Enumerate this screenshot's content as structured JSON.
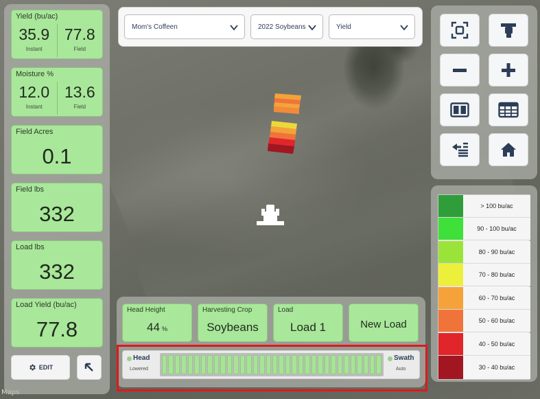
{
  "metrics": {
    "yield": {
      "title": "Yield (bu/ac)",
      "instant": "35.9",
      "instant_label": "Instant",
      "field": "77.8",
      "field_label": "Field"
    },
    "moisture": {
      "title": "Moisture %",
      "instant": "12.0",
      "instant_label": "Instant",
      "field": "13.6",
      "field_label": "Field"
    },
    "field_acres": {
      "title": "Field Acres",
      "value": "0.1"
    },
    "field_lbs": {
      "title": "Field lbs",
      "value": "332"
    },
    "load_lbs": {
      "title": "Load lbs",
      "value": "332"
    },
    "load_yield": {
      "title": "Load Yield (bu/ac)",
      "value": "77.8"
    }
  },
  "edit_button": {
    "label": "EDIT",
    "icon": "gear-icon"
  },
  "expand_button": {
    "icon": "arrow-up-left-icon"
  },
  "selects": {
    "farm": "Mom's Coffeen",
    "crop_year": "2022 Soybeans",
    "layer": "Yield"
  },
  "right_buttons": [
    {
      "name": "focus-button",
      "icon": "focus-frame-icon"
    },
    {
      "name": "combine-view-button",
      "icon": "combine-icon"
    },
    {
      "name": "zoom-out-button",
      "icon": "minus-icon"
    },
    {
      "name": "zoom-in-button",
      "icon": "plus-icon"
    },
    {
      "name": "split-view-button",
      "icon": "split-view-icon"
    },
    {
      "name": "table-view-button",
      "icon": "table-icon"
    },
    {
      "name": "transfer-button",
      "icon": "transfer-list-icon"
    },
    {
      "name": "home-button",
      "icon": "home-icon"
    }
  ],
  "legend": [
    {
      "label": "> 100 bu/ac",
      "color": "#2f9e3a"
    },
    {
      "label": "90 - 100 bu/ac",
      "color": "#3fe03a"
    },
    {
      "label": "80 - 90 bu/ac",
      "color": "#9ae43a"
    },
    {
      "label": "70 - 80 bu/ac",
      "color": "#ecf03a"
    },
    {
      "label": "60 - 70 bu/ac",
      "color": "#f6a23a"
    },
    {
      "label": "50 - 60 bu/ac",
      "color": "#f0743a"
    },
    {
      "label": "40 - 50 bu/ac",
      "color": "#e0262a"
    },
    {
      "label": "30 - 40 bu/ac",
      "color": "#a11620"
    }
  ],
  "info_cards": {
    "head_height": {
      "title": "Head Height",
      "value": "44",
      "unit": "%"
    },
    "harvesting_crop": {
      "title": "Harvesting Crop",
      "value": "Soybeans"
    },
    "load": {
      "title": "Load",
      "value": "Load 1"
    },
    "new_load": {
      "label": "New Load"
    }
  },
  "swath": {
    "head_label": "Head",
    "head_state": "Lowered",
    "swath_label": "Swath",
    "swath_state": "Auto"
  },
  "map_attribution": "Maps"
}
